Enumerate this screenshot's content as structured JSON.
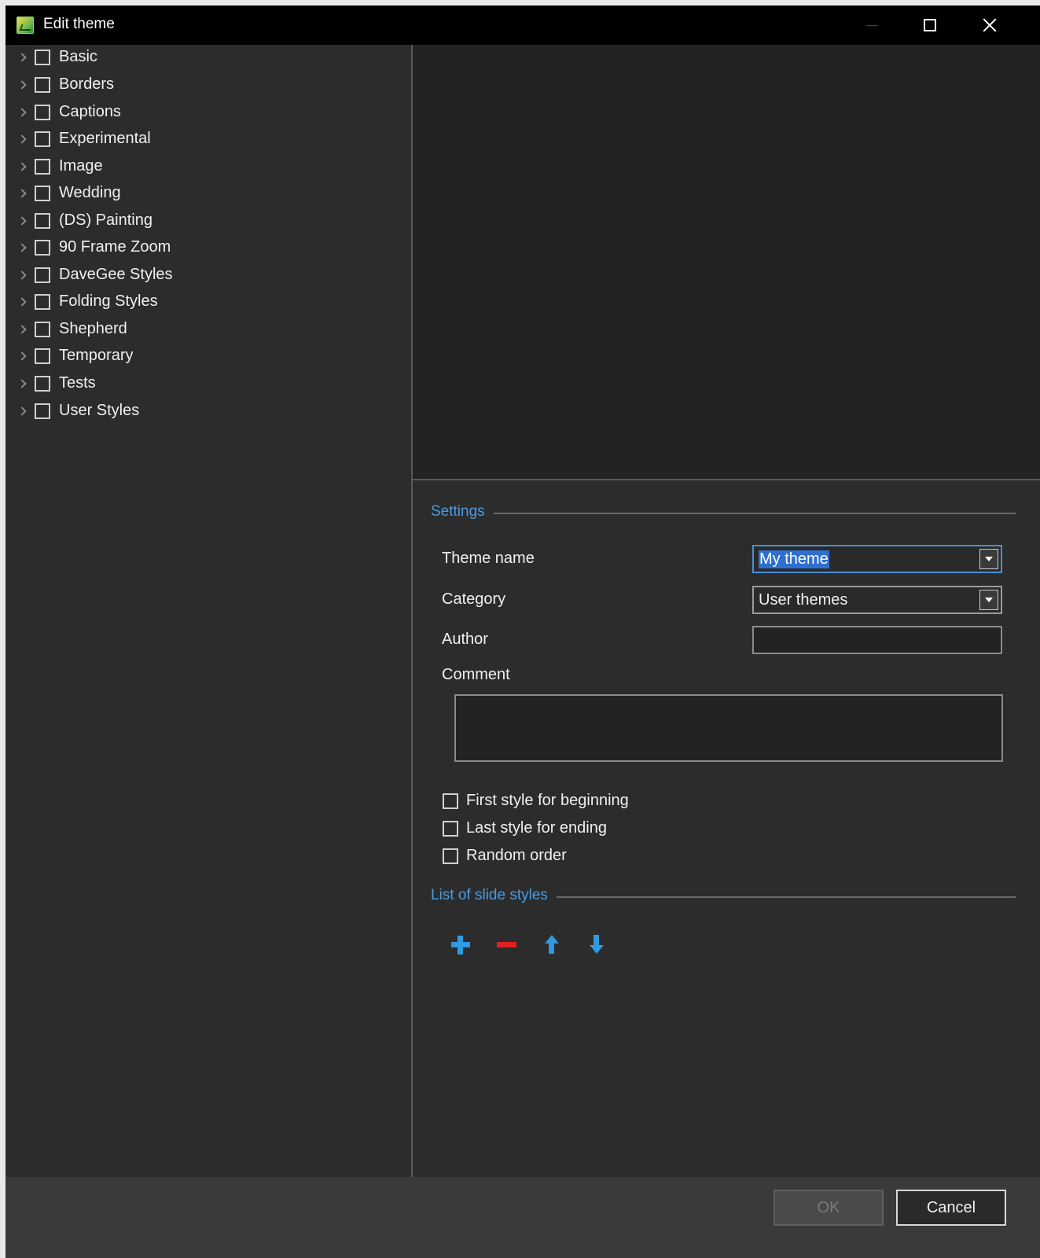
{
  "window": {
    "title": "Edit theme"
  },
  "tree": {
    "items": [
      {
        "label": "Basic"
      },
      {
        "label": "Borders"
      },
      {
        "label": "Captions"
      },
      {
        "label": "Experimental"
      },
      {
        "label": "Image"
      },
      {
        "label": "Wedding"
      },
      {
        "label": "(DS) Painting"
      },
      {
        "label": "90 Frame Zoom"
      },
      {
        "label": "DaveGee Styles"
      },
      {
        "label": "Folding Styles"
      },
      {
        "label": "Shepherd"
      },
      {
        "label": "Temporary"
      },
      {
        "label": "Tests"
      },
      {
        "label": "User Styles"
      }
    ]
  },
  "settings": {
    "section_title": "Settings",
    "theme_name_label": "Theme name",
    "theme_name_value": "My theme",
    "category_label": "Category",
    "category_value": "User themes",
    "author_label": "Author",
    "author_value": "",
    "comment_label": "Comment",
    "comment_value": "",
    "checkboxes": [
      {
        "label": "First style for beginning",
        "checked": false
      },
      {
        "label": "Last style for ending",
        "checked": false
      },
      {
        "label": "Random order",
        "checked": false
      }
    ]
  },
  "slide_styles": {
    "section_title": "List of slide styles",
    "toolbar": [
      "plus-icon",
      "minus-icon",
      "arrow-up-icon",
      "arrow-down-icon"
    ]
  },
  "footer": {
    "ok_label": "OK",
    "cancel_label": "Cancel"
  },
  "colors": {
    "accent": "#4a9be0",
    "add_icon": "#2f9ae0",
    "remove_icon": "#e02020",
    "background": "#2c2c2c"
  }
}
